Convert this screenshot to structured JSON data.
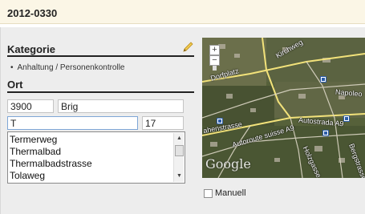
{
  "header": {
    "title": "2012-0330"
  },
  "category": {
    "heading": "Kategorie",
    "edit_icon": "pencil-icon",
    "items": [
      "Anhaltung / Personenkontrolle"
    ]
  },
  "location": {
    "heading": "Ort",
    "postal_code": "3900",
    "city": "Brig",
    "street": "T",
    "house_number": "17",
    "suggestions": [
      "Termerweg",
      "Thermalbad",
      "Thermalbadstrasse",
      "Tolaweg"
    ]
  },
  "map": {
    "zoom_in": "+",
    "zoom_out": "−",
    "labels": {
      "dorfplatz": "Dorfplatz",
      "kirchweg": "Kirchweg",
      "napoleon": "Napoleo",
      "ahenstrasse": "ahenstrasse",
      "autoroute": "Autoroute suisse A9",
      "autostrada": "Autostrada A9",
      "holzgasse": "Holzgasse",
      "bergstrasse": "Bergstrasse"
    },
    "attribution": "Google",
    "colors": {
      "satellite_base": "#4f5a36",
      "road": "#f2e27a",
      "marker": "#2c5da8"
    }
  },
  "manual_toggle": {
    "label": "Manuell",
    "checked": false
  },
  "colors": {
    "header_bg": "#fbf6e6",
    "panel_bg": "#ededed",
    "accent_pencil": "#e8b93a"
  }
}
